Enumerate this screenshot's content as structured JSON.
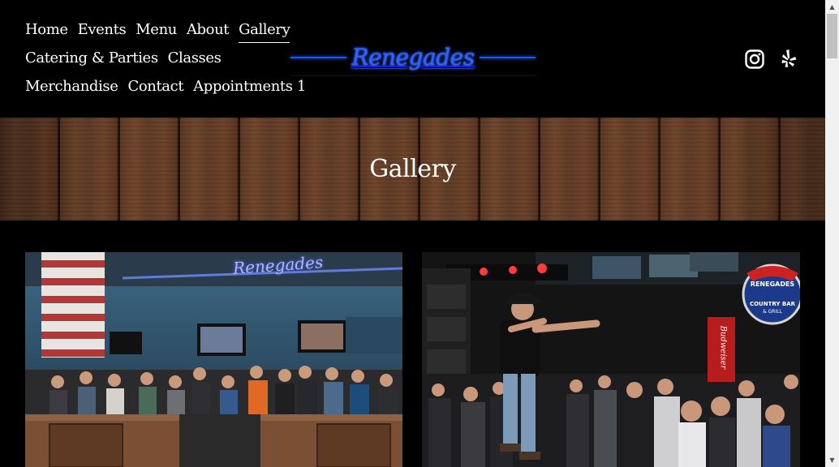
{
  "nav": {
    "items": [
      {
        "label": "Home"
      },
      {
        "label": "Events"
      },
      {
        "label": "Menu"
      },
      {
        "label": "About"
      },
      {
        "label": "Gallery",
        "active": true
      },
      {
        "label": "Catering & Parties"
      },
      {
        "label": "Classes"
      },
      {
        "label": "Merchandise"
      },
      {
        "label": "Contact"
      },
      {
        "label": "Appointments 1"
      }
    ]
  },
  "logo": {
    "text": "Renegades",
    "color": "#2a63ff"
  },
  "social": {
    "icons": [
      "instagram-icon",
      "yelp-icon"
    ]
  },
  "banner": {
    "title": "Gallery"
  },
  "gallery": {
    "photo1": {
      "sign_text": "Renegades"
    },
    "photo2": {
      "badge_line1": "RENEGADES",
      "badge_line2": "COUNTRY BAR",
      "badge_line3": "& GRILL",
      "banner_text": "Budweiser"
    }
  },
  "colors": {
    "background": "#000000",
    "text": "#ffffff",
    "neon_blue": "#2a63ff"
  }
}
